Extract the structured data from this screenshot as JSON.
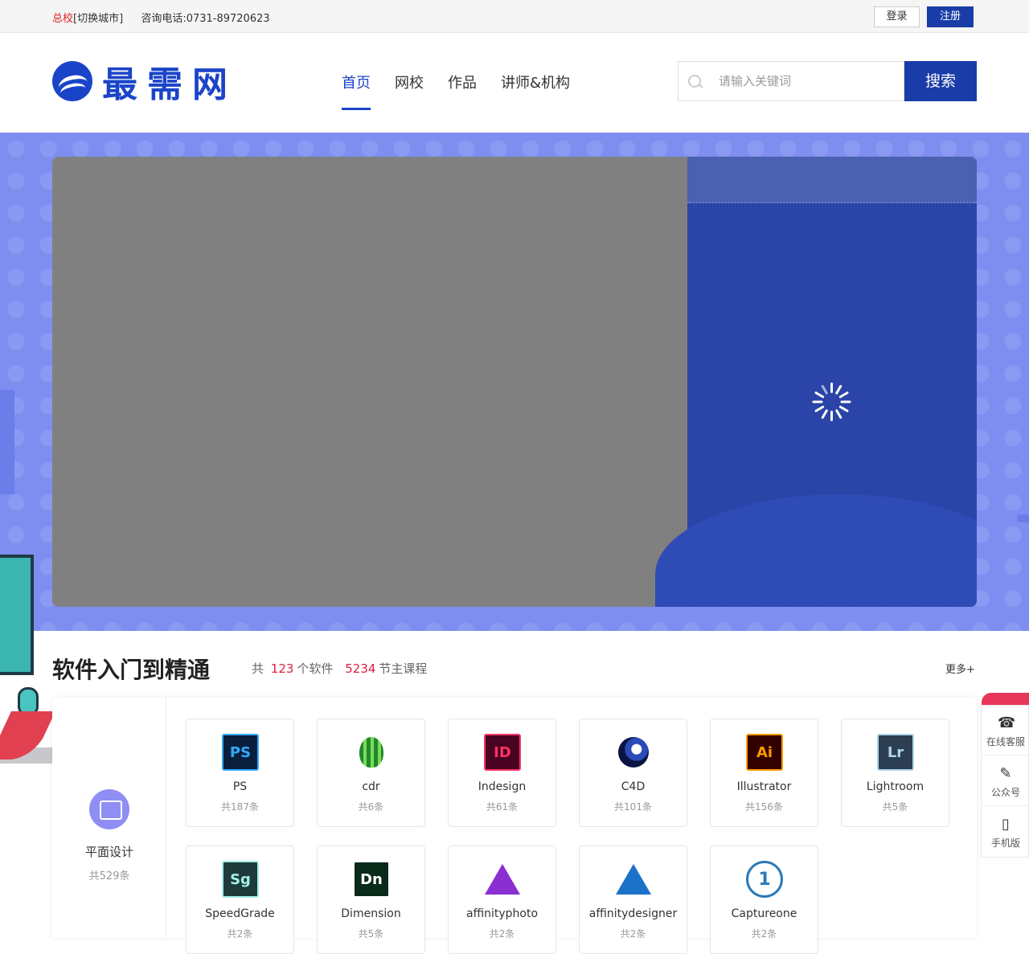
{
  "topbar": {
    "campus": "总校",
    "switch_city": "[切换城市]",
    "phone": "咨询电话:0731-89720623",
    "login": "登录",
    "register": "注册"
  },
  "logo": {
    "text": "最需网"
  },
  "nav": {
    "items": [
      {
        "label": "首页",
        "active": true
      },
      {
        "label": "网校"
      },
      {
        "label": "作品"
      },
      {
        "label": "讲师&机构"
      }
    ]
  },
  "search": {
    "placeholder": "请输入关键词",
    "button": "搜索"
  },
  "section": {
    "title": "软件入门到精通",
    "stats_prefix": "共",
    "software_count": "123",
    "software_suffix": "个软件",
    "lessons_count": "5234",
    "lessons_suffix": "节主课程",
    "more": "更多+"
  },
  "category": {
    "name": "平面设计",
    "count": "共529条",
    "icon": "image-icon",
    "color": "#8f8ef5"
  },
  "cards": [
    {
      "name": "PS",
      "count": "共187条",
      "icon_text": "PS",
      "bg": "#0a1f3c",
      "fg": "#31a8ff",
      "icon": "photoshop-icon"
    },
    {
      "name": "cdr",
      "count": "共6条",
      "icon_text": "",
      "bg": "#ffffff",
      "fg": "#1e8a2e",
      "icon": "coreldraw-balloon-icon"
    },
    {
      "name": "Indesign",
      "count": "共61条",
      "icon_text": "ID",
      "bg": "#49021f",
      "fg": "#ff3366",
      "icon": "indesign-icon"
    },
    {
      "name": "C4D",
      "count": "共101条",
      "icon_text": "",
      "bg": "#ffffff",
      "fg": "#1a2a6a",
      "icon": "cinema4d-icon"
    },
    {
      "name": "Illustrator",
      "count": "共156条",
      "icon_text": "Ai",
      "bg": "#330000",
      "fg": "#ff9a00",
      "icon": "illustrator-icon"
    },
    {
      "name": "Lightroom",
      "count": "共5条",
      "icon_text": "Lr",
      "bg": "#2c3e52",
      "fg": "#add5ec",
      "icon": "lightroom-icon"
    },
    {
      "name": "SpeedGrade",
      "count": "共2条",
      "icon_text": "Sg",
      "bg": "#1f3a3a",
      "fg": "#9ff0e8",
      "icon": "speedgrade-icon"
    },
    {
      "name": "Dimension",
      "count": "共5条",
      "icon_text": "Dn",
      "bg": "#0a2a1a",
      "fg": "#ffffff",
      "icon": "dimension-icon"
    },
    {
      "name": "affinityphoto",
      "count": "共2条",
      "icon_text": "",
      "bg": "#ffffff",
      "fg": "#7b2fbf",
      "icon": "affinity-photo-icon"
    },
    {
      "name": "affinitydesigner",
      "count": "共2条",
      "icon_text": "",
      "bg": "#ffffff",
      "fg": "#1b72c8",
      "icon": "affinity-designer-icon"
    },
    {
      "name": "Captureone",
      "count": "共2条",
      "icon_text": "1",
      "bg": "#ffffff",
      "fg": "#2a7ab8",
      "icon": "captureone-icon"
    }
  ],
  "floatbar": [
    {
      "label": "在线客服",
      "icon": "headset-icon"
    },
    {
      "label": "公众号",
      "icon": "edit-icon"
    },
    {
      "label": "手机版",
      "icon": "phone-icon"
    }
  ],
  "colors": {
    "brand": "#1a3ca8",
    "accent_red": "#e02040",
    "banner_bg": "#7d8ef0"
  }
}
